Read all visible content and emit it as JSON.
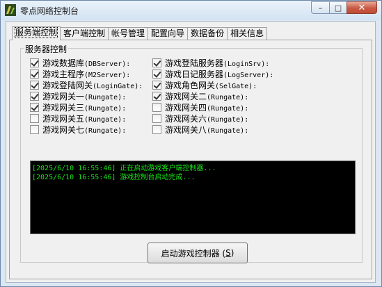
{
  "window": {
    "title": "零点网络控制台"
  },
  "caption": {
    "min": "–",
    "max": "□",
    "close": "✕"
  },
  "tabs": [
    {
      "label": "服务端控制"
    },
    {
      "label": "客户端控制"
    },
    {
      "label": "帐号管理"
    },
    {
      "label": "配置向导"
    },
    {
      "label": "数据备份"
    },
    {
      "label": "相关信息"
    }
  ],
  "group": {
    "title": "服务器控制"
  },
  "servers": [
    {
      "cn": "游戏数据库",
      "en": "(DBServer):",
      "checked": true
    },
    {
      "cn": "游戏登陆服务器",
      "en": "(LoginSrv):",
      "checked": true
    },
    {
      "cn": "游戏主程序",
      "en": "(M2Server):",
      "checked": true
    },
    {
      "cn": "游戏日记服务器",
      "en": "(LogServer):",
      "checked": true
    },
    {
      "cn": "游戏登陆网关",
      "en": "(LoginGate):",
      "checked": true
    },
    {
      "cn": "游戏角色网关",
      "en": "(SelGate):",
      "checked": true
    },
    {
      "cn": "游戏网关一",
      "en": "(Rungate):",
      "checked": true
    },
    {
      "cn": "游戏网关二",
      "en": "(Rungate):",
      "checked": true
    },
    {
      "cn": "游戏网关三",
      "en": "(Rungate):",
      "checked": true
    },
    {
      "cn": "游戏网关四",
      "en": "(Rungate):",
      "checked": false
    },
    {
      "cn": "游戏网关五",
      "en": "(Rungate):",
      "checked": false
    },
    {
      "cn": "游戏网关六",
      "en": "(Rungate):",
      "checked": false
    },
    {
      "cn": "游戏网关七",
      "en": "(Rungate):",
      "checked": false
    },
    {
      "cn": "游戏网关八",
      "en": "(Rungate):",
      "checked": false
    }
  ],
  "log": [
    "[2025/6/10 16:55:46] 正在启动游戏客户端控制器...",
    "[2025/6/10 16:55:46] 游戏控制台启动完成..."
  ],
  "start_button": {
    "label": "启动游戏控制器 (",
    "hotkey": "S",
    "suffix": ")"
  },
  "colors": {
    "log_text": "#19e619",
    "log_bg": "#000000"
  }
}
